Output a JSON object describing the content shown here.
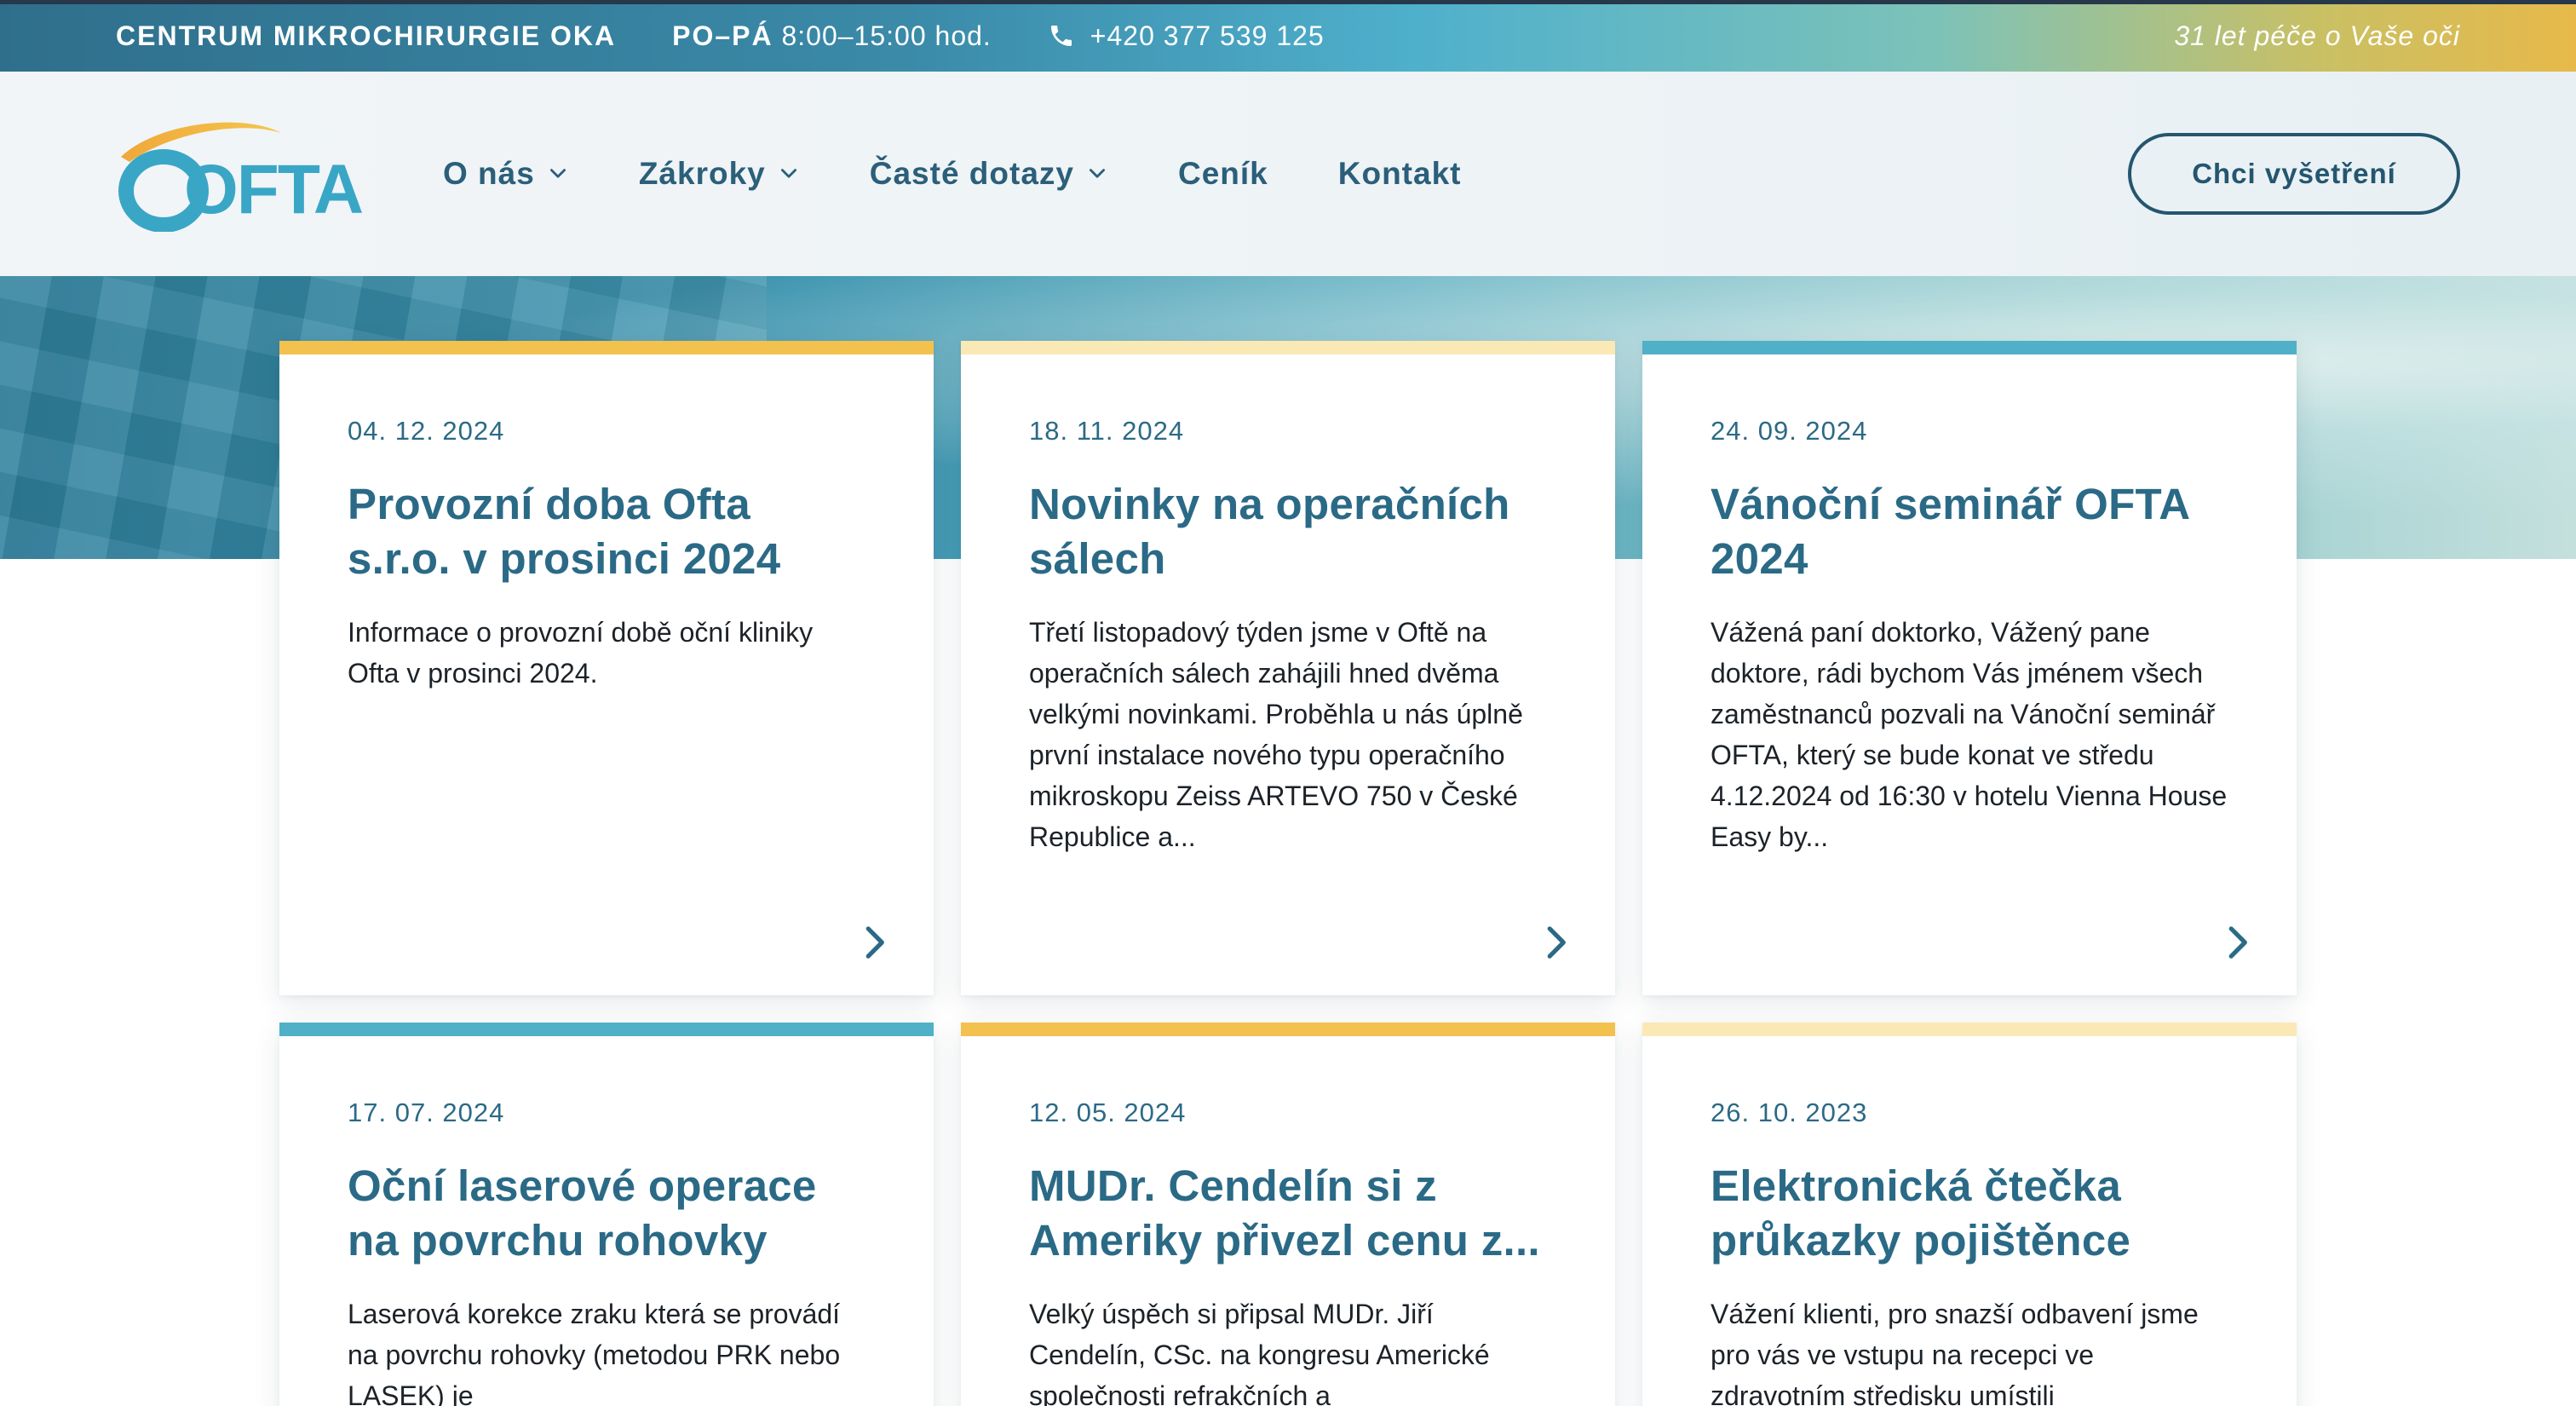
{
  "topbar": {
    "brand": "CENTRUM MIKROCHIRURGIE OKA",
    "hours_days": "PO–PÁ",
    "hours_time": "8:00–15:00 hod.",
    "phone": "+420 377 539 125",
    "motto": "31 let péče o Vaše oči"
  },
  "header": {
    "logo_text": "OFTA",
    "nav": [
      {
        "label": "O nás",
        "has_dropdown": true
      },
      {
        "label": "Zákroky",
        "has_dropdown": true
      },
      {
        "label": "Časté dotazy",
        "has_dropdown": true
      },
      {
        "label": "Ceník",
        "has_dropdown": false
      },
      {
        "label": "Kontakt",
        "has_dropdown": false
      }
    ],
    "cta_label": "Chci vyšetření"
  },
  "colors": {
    "accent_blue": "#2b6a86",
    "bar_yellow": "#f2c14e",
    "bar_light_yellow": "#fbe9b5",
    "bar_cyan": "#4fb0c8"
  },
  "cards": [
    {
      "date": "04. 12. 2024",
      "title": "Provozní doba Ofta s.r.o. v prosinci 2024",
      "excerpt": "Informace o provozní době oční kliniky Ofta v prosinci 2024.",
      "bar_color": "#f2c14e"
    },
    {
      "date": "18. 11. 2024",
      "title": "Novinky na operačních sálech",
      "excerpt": "Třetí listopadový týden jsme v Oftě na operačních sálech zahájili hned dvěma velkými novinkami. Proběhla u nás úplně první instalace nového typu operačního mikroskopu Zeiss ARTEVO 750 v České Republice a...",
      "bar_color": "#fbe9b5"
    },
    {
      "date": "24. 09. 2024",
      "title": "Vánoční seminář OFTA 2024",
      "excerpt": "Vážená paní doktorko, Vážený pane doktore, rádi bychom Vás jménem všech zaměstnanců pozvali na Vánoční seminář OFTA, který se bude konat ve středu 4.12.2024 od 16:30 v hotelu Vienna House Easy by...",
      "bar_color": "#4fb0c8"
    },
    {
      "date": "17. 07. 2024",
      "title": "Oční laserové operace na povrchu rohovky",
      "excerpt": "Laserová korekce zraku která se provádí na povrchu rohovky (metodou PRK nebo LASEK) je",
      "bar_color": "#4fb0c8"
    },
    {
      "date": "12. 05. 2024",
      "title": "MUDr. Cendelín si z Ameriky přivezl cenu z...",
      "excerpt": "Velký úspěch si připsal MUDr. Jiří Cendelín, CSc. na kongresu Americké společnosti refrakčních a",
      "bar_color": "#f2c14e"
    },
    {
      "date": "26. 10. 2023",
      "title": "Elektronická čtečka průkazky pojištěnce",
      "excerpt": "Vážení klienti, pro snazší odbavení jsme pro vás ve vstupu na recepci ve zdravotním středisku umístili",
      "bar_color": "#fbe9b5"
    }
  ]
}
